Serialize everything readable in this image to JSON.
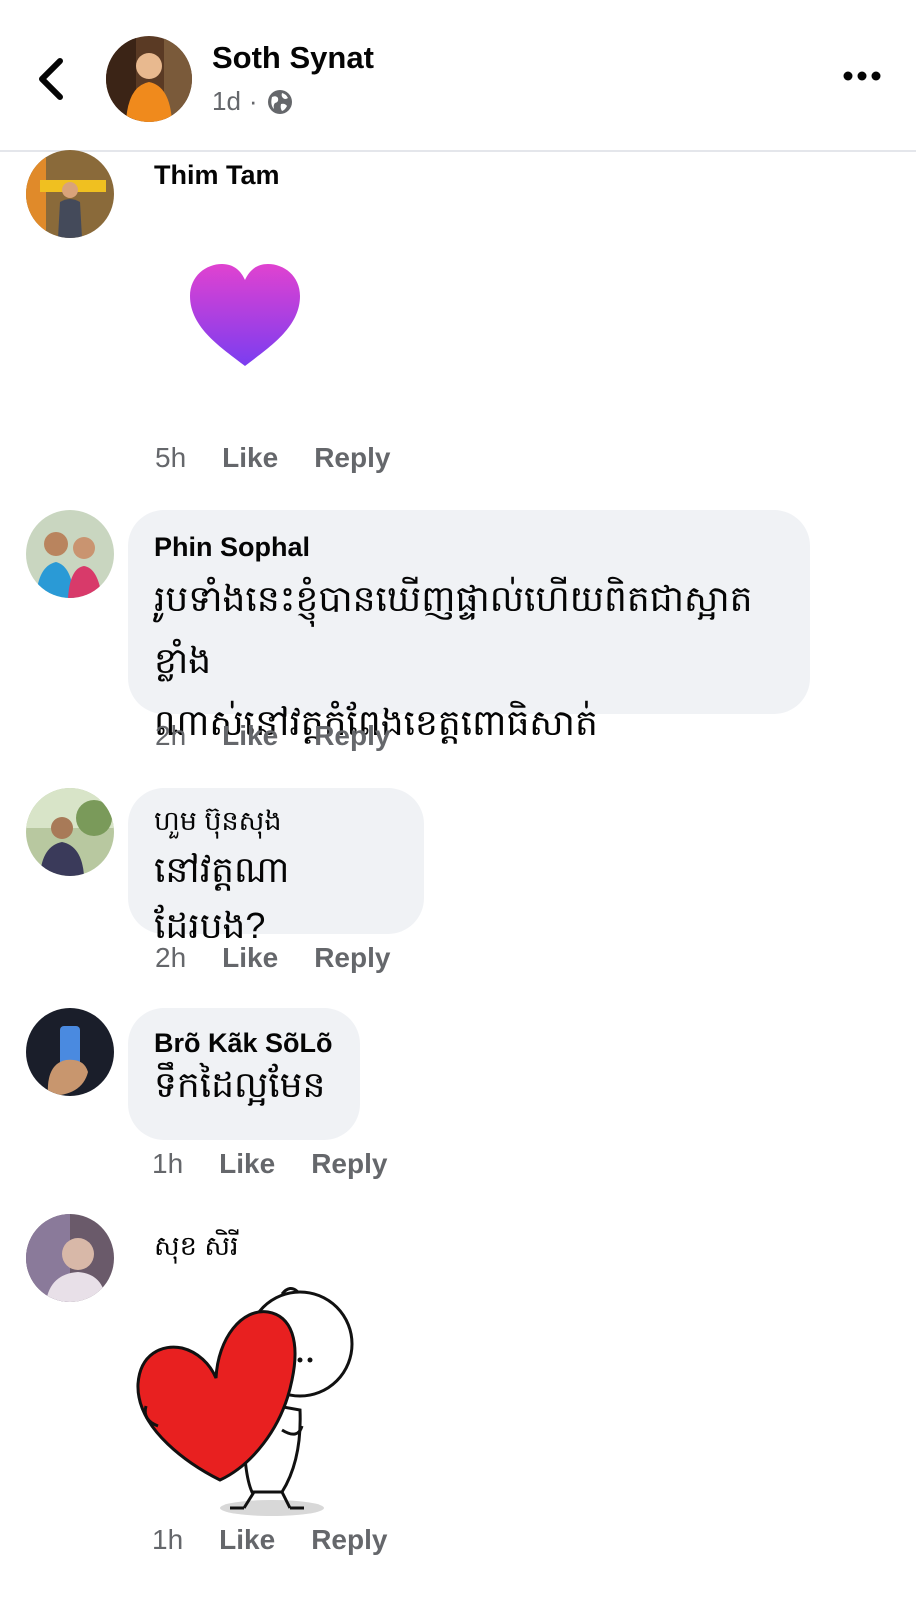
{
  "header": {
    "poster_name": "Soth Synat",
    "post_age": "1d",
    "separator": "·",
    "privacy_icon": "globe-icon"
  },
  "colors": {
    "bubble_bg": "#f0f2f5",
    "meta_text": "#65676b",
    "heart_sticker_top": "#e042d0",
    "heart_sticker_bottom": "#7b3df0",
    "hug_heart_red": "#e82020"
  },
  "comments": [
    {
      "author": "Thim Tam",
      "sticker": "purple-heart-sticker",
      "time": "5h",
      "like": "Like",
      "reply": "Reply"
    },
    {
      "author": "Phin Sophal",
      "text": [
        "រូបទាំងនេះខ្ញុំបានឃើញផ្ទាល់ហើយពិតជាស្អាតខ្លាំង",
        "ណាស់នៅវត្តកំពែងខេត្តពោធិសាត់"
      ],
      "time": "2h",
      "like": "Like",
      "reply": "Reply"
    },
    {
      "author": "ហួម ប៊ុនសុង",
      "text": [
        "នៅវត្តណាដែរបង?"
      ],
      "time": "2h",
      "like": "Like",
      "reply": "Reply"
    },
    {
      "author": "Brõ Kãk SõLõ",
      "text": [
        "ទឹកដៃល្អមែន"
      ],
      "time": "1h",
      "like": "Like",
      "reply": "Reply"
    },
    {
      "author": "សុខ សិរី",
      "sticker": "hugging-heart-sticker",
      "time": "1h",
      "like": "Like",
      "reply": "Reply"
    }
  ]
}
